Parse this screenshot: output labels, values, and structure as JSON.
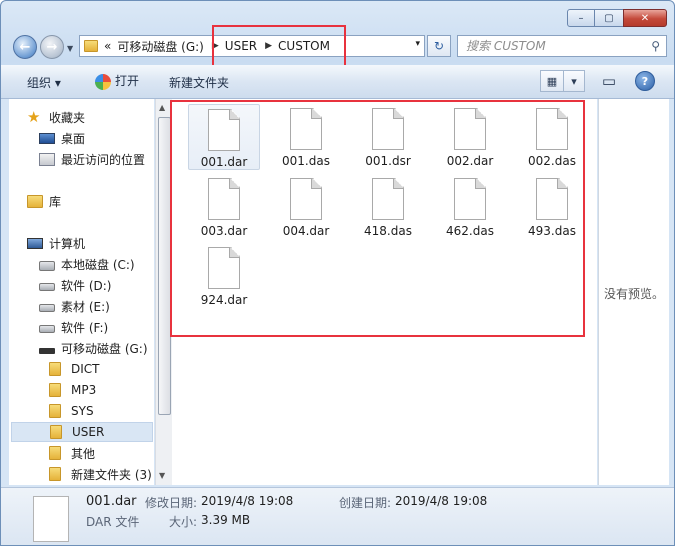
{
  "window": {
    "caption": {
      "minimize": "–",
      "maximize": "▢",
      "close": "✕"
    }
  },
  "address_bar": {
    "overflow": "«",
    "segments": [
      "可移动磁盘 (G:)",
      "USER",
      "CUSTOM"
    ],
    "dropdown": "▾",
    "refresh": "↻"
  },
  "search": {
    "placeholder": "搜索 CUSTOM",
    "icon": "search-icon"
  },
  "toolbar": {
    "organize": "组织 ▾",
    "open": "打开",
    "new_folder": "新建文件夹",
    "view_icon": "view-options-icon",
    "view_dd": "▾",
    "preview_pane": "▭",
    "help": "?"
  },
  "nav_pane": {
    "items": [
      {
        "label": "收藏夹",
        "icon": "star-icon"
      },
      {
        "label": "桌面",
        "icon": "desktop-icon"
      },
      {
        "label": "最近访问的位置",
        "icon": "recent-places-icon"
      },
      {
        "label": "库",
        "icon": "library-icon"
      },
      {
        "label": "计算机",
        "icon": "computer-icon"
      },
      {
        "label": "本地磁盘 (C:)",
        "icon": "system-drive-icon"
      },
      {
        "label": "软件 (D:)",
        "icon": "drive-icon"
      },
      {
        "label": "素材 (E:)",
        "icon": "drive-icon"
      },
      {
        "label": "软件 (F:)",
        "icon": "drive-icon"
      },
      {
        "label": "可移动磁盘 (G:)",
        "icon": "removable-drive-icon"
      },
      {
        "label": "DICT",
        "icon": "folder-icon"
      },
      {
        "label": "MP3",
        "icon": "folder-icon"
      },
      {
        "label": "SYS",
        "icon": "folder-icon"
      },
      {
        "label": "USER",
        "icon": "folder-icon"
      },
      {
        "label": "其他",
        "icon": "folder-icon"
      },
      {
        "label": "新建文件夹 (3)",
        "icon": "folder-icon"
      }
    ],
    "selected": "USER"
  },
  "files": [
    "001.dar",
    "001.das",
    "001.dsr",
    "002.dar",
    "002.das",
    "003.dar",
    "004.dar",
    "418.das",
    "462.das",
    "493.das",
    "924.dar"
  ],
  "preview_text": "没有预览。",
  "details": {
    "name": "001.dar",
    "type": "DAR 文件",
    "modified_label": "修改日期:",
    "modified_value": "2019/4/8 19:08",
    "created_label": "创建日期:",
    "created_value": "2019/4/8 19:08",
    "size_label": "大小:",
    "size_value": "3.39 MB"
  },
  "colors": {
    "highlight": "#e8323e",
    "selection": "#d9e6f4"
  }
}
